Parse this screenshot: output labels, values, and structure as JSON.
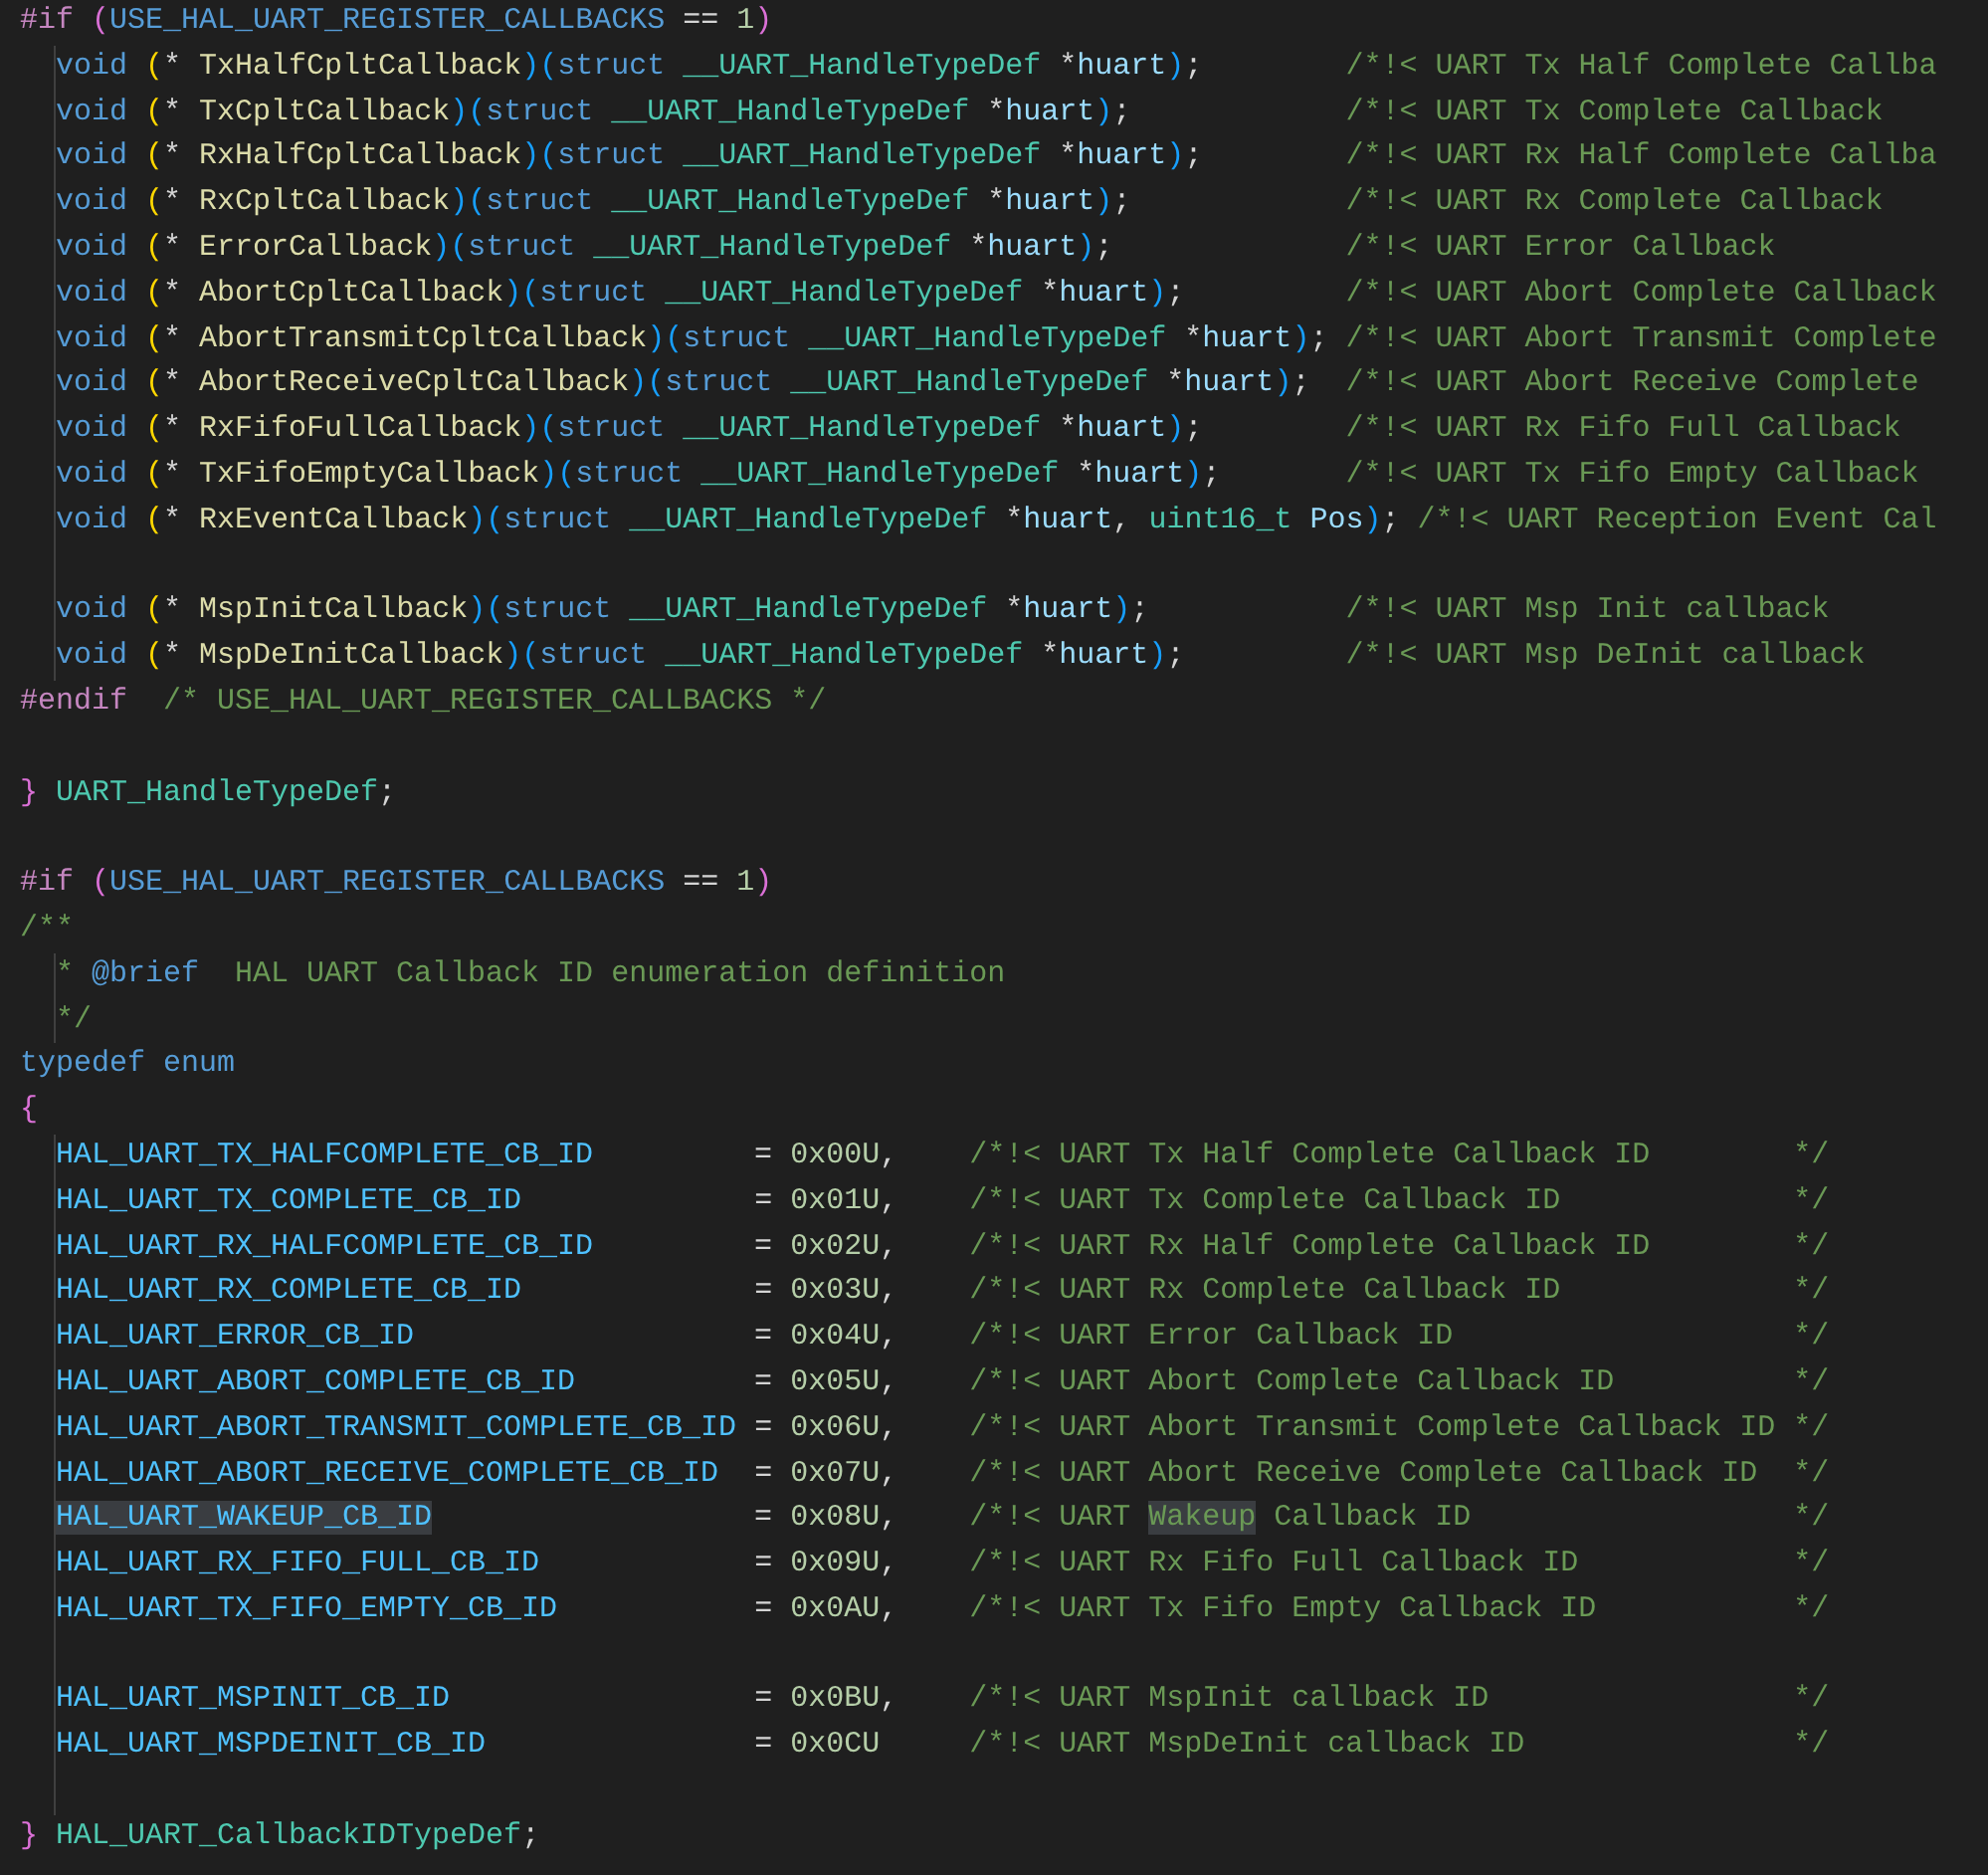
{
  "editor": {
    "lines": [
      {
        "nested": false,
        "tokens": [
          {
            "kind": "pp",
            "text": "#if "
          },
          {
            "kind": "b2",
            "text": "("
          },
          {
            "kind": "macro",
            "text": "USE_HAL_UART_REGISTER_CALLBACKS"
          },
          {
            "kind": "plain",
            "text": " == "
          },
          {
            "kind": "num",
            "text": "1"
          },
          {
            "kind": "b2",
            "text": ")"
          }
        ]
      },
      {
        "nested": true,
        "tokens": [
          {
            "kind": "kw",
            "text": "void "
          },
          {
            "kind": "b1",
            "text": "("
          },
          {
            "kind": "plain",
            "text": "* "
          },
          {
            "kind": "fn",
            "text": "TxHalfCpltCallback"
          },
          {
            "kind": "b3",
            "text": ")("
          },
          {
            "kind": "kw",
            "text": "struct "
          },
          {
            "kind": "type",
            "text": "__UART_HandleTypeDef "
          },
          {
            "kind": "plain",
            "text": "*"
          },
          {
            "kind": "param",
            "text": "huart"
          },
          {
            "kind": "b3",
            "text": ")"
          },
          {
            "kind": "plain",
            "text": ";        "
          },
          {
            "kind": "cm",
            "text": "/*!< UART Tx Half Complete Callba"
          }
        ]
      },
      {
        "nested": true,
        "tokens": [
          {
            "kind": "kw",
            "text": "void "
          },
          {
            "kind": "b1",
            "text": "("
          },
          {
            "kind": "plain",
            "text": "* "
          },
          {
            "kind": "fn",
            "text": "TxCpltCallback"
          },
          {
            "kind": "b3",
            "text": ")("
          },
          {
            "kind": "kw",
            "text": "struct "
          },
          {
            "kind": "type",
            "text": "__UART_HandleTypeDef "
          },
          {
            "kind": "plain",
            "text": "*"
          },
          {
            "kind": "param",
            "text": "huart"
          },
          {
            "kind": "b3",
            "text": ")"
          },
          {
            "kind": "plain",
            "text": ";            "
          },
          {
            "kind": "cm",
            "text": "/*!< UART Tx Complete Callback"
          }
        ]
      },
      {
        "nested": true,
        "tokens": [
          {
            "kind": "kw",
            "text": "void "
          },
          {
            "kind": "b1",
            "text": "("
          },
          {
            "kind": "plain",
            "text": "* "
          },
          {
            "kind": "fn",
            "text": "RxHalfCpltCallback"
          },
          {
            "kind": "b3",
            "text": ")("
          },
          {
            "kind": "kw",
            "text": "struct "
          },
          {
            "kind": "type",
            "text": "__UART_HandleTypeDef "
          },
          {
            "kind": "plain",
            "text": "*"
          },
          {
            "kind": "param",
            "text": "huart"
          },
          {
            "kind": "b3",
            "text": ")"
          },
          {
            "kind": "plain",
            "text": ";        "
          },
          {
            "kind": "cm",
            "text": "/*!< UART Rx Half Complete Callba"
          }
        ]
      },
      {
        "nested": true,
        "tokens": [
          {
            "kind": "kw",
            "text": "void "
          },
          {
            "kind": "b1",
            "text": "("
          },
          {
            "kind": "plain",
            "text": "* "
          },
          {
            "kind": "fn",
            "text": "RxCpltCallback"
          },
          {
            "kind": "b3",
            "text": ")("
          },
          {
            "kind": "kw",
            "text": "struct "
          },
          {
            "kind": "type",
            "text": "__UART_HandleTypeDef "
          },
          {
            "kind": "plain",
            "text": "*"
          },
          {
            "kind": "param",
            "text": "huart"
          },
          {
            "kind": "b3",
            "text": ")"
          },
          {
            "kind": "plain",
            "text": ";            "
          },
          {
            "kind": "cm",
            "text": "/*!< UART Rx Complete Callback"
          }
        ]
      },
      {
        "nested": true,
        "tokens": [
          {
            "kind": "kw",
            "text": "void "
          },
          {
            "kind": "b1",
            "text": "("
          },
          {
            "kind": "plain",
            "text": "* "
          },
          {
            "kind": "fn",
            "text": "ErrorCallback"
          },
          {
            "kind": "b3",
            "text": ")("
          },
          {
            "kind": "kw",
            "text": "struct "
          },
          {
            "kind": "type",
            "text": "__UART_HandleTypeDef "
          },
          {
            "kind": "plain",
            "text": "*"
          },
          {
            "kind": "param",
            "text": "huart"
          },
          {
            "kind": "b3",
            "text": ")"
          },
          {
            "kind": "plain",
            "text": ";             "
          },
          {
            "kind": "cm",
            "text": "/*!< UART Error Callback"
          }
        ]
      },
      {
        "nested": true,
        "tokens": [
          {
            "kind": "kw",
            "text": "void "
          },
          {
            "kind": "b1",
            "text": "("
          },
          {
            "kind": "plain",
            "text": "* "
          },
          {
            "kind": "fn",
            "text": "AbortCpltCallback"
          },
          {
            "kind": "b3",
            "text": ")("
          },
          {
            "kind": "kw",
            "text": "struct "
          },
          {
            "kind": "type",
            "text": "__UART_HandleTypeDef "
          },
          {
            "kind": "plain",
            "text": "*"
          },
          {
            "kind": "param",
            "text": "huart"
          },
          {
            "kind": "b3",
            "text": ")"
          },
          {
            "kind": "plain",
            "text": ";         "
          },
          {
            "kind": "cm",
            "text": "/*!< UART Abort Complete Callback"
          }
        ]
      },
      {
        "nested": true,
        "tokens": [
          {
            "kind": "kw",
            "text": "void "
          },
          {
            "kind": "b1",
            "text": "("
          },
          {
            "kind": "plain",
            "text": "* "
          },
          {
            "kind": "fn",
            "text": "AbortTransmitCpltCallback"
          },
          {
            "kind": "b3",
            "text": ")("
          },
          {
            "kind": "kw",
            "text": "struct "
          },
          {
            "kind": "type",
            "text": "__UART_HandleTypeDef "
          },
          {
            "kind": "plain",
            "text": "*"
          },
          {
            "kind": "param",
            "text": "huart"
          },
          {
            "kind": "b3",
            "text": ")"
          },
          {
            "kind": "plain",
            "text": "; "
          },
          {
            "kind": "cm",
            "text": "/*!< UART Abort Transmit Complete"
          }
        ]
      },
      {
        "nested": true,
        "tokens": [
          {
            "kind": "kw",
            "text": "void "
          },
          {
            "kind": "b1",
            "text": "("
          },
          {
            "kind": "plain",
            "text": "* "
          },
          {
            "kind": "fn",
            "text": "AbortReceiveCpltCallback"
          },
          {
            "kind": "b3",
            "text": ")("
          },
          {
            "kind": "kw",
            "text": "struct "
          },
          {
            "kind": "type",
            "text": "__UART_HandleTypeDef "
          },
          {
            "kind": "plain",
            "text": "*"
          },
          {
            "kind": "param",
            "text": "huart"
          },
          {
            "kind": "b3",
            "text": ")"
          },
          {
            "kind": "plain",
            "text": ";  "
          },
          {
            "kind": "cm",
            "text": "/*!< UART Abort Receive Complete"
          }
        ]
      },
      {
        "nested": true,
        "tokens": [
          {
            "kind": "kw",
            "text": "void "
          },
          {
            "kind": "b1",
            "text": "("
          },
          {
            "kind": "plain",
            "text": "* "
          },
          {
            "kind": "fn",
            "text": "RxFifoFullCallback"
          },
          {
            "kind": "b3",
            "text": ")("
          },
          {
            "kind": "kw",
            "text": "struct "
          },
          {
            "kind": "type",
            "text": "__UART_HandleTypeDef "
          },
          {
            "kind": "plain",
            "text": "*"
          },
          {
            "kind": "param",
            "text": "huart"
          },
          {
            "kind": "b3",
            "text": ")"
          },
          {
            "kind": "plain",
            "text": ";        "
          },
          {
            "kind": "cm",
            "text": "/*!< UART Rx Fifo Full Callback"
          }
        ]
      },
      {
        "nested": true,
        "tokens": [
          {
            "kind": "kw",
            "text": "void "
          },
          {
            "kind": "b1",
            "text": "("
          },
          {
            "kind": "plain",
            "text": "* "
          },
          {
            "kind": "fn",
            "text": "TxFifoEmptyCallback"
          },
          {
            "kind": "b3",
            "text": ")("
          },
          {
            "kind": "kw",
            "text": "struct "
          },
          {
            "kind": "type",
            "text": "__UART_HandleTypeDef "
          },
          {
            "kind": "plain",
            "text": "*"
          },
          {
            "kind": "param",
            "text": "huart"
          },
          {
            "kind": "b3",
            "text": ")"
          },
          {
            "kind": "plain",
            "text": ";       "
          },
          {
            "kind": "cm",
            "text": "/*!< UART Tx Fifo Empty Callback"
          }
        ]
      },
      {
        "nested": true,
        "tokens": [
          {
            "kind": "kw",
            "text": "void "
          },
          {
            "kind": "b1",
            "text": "("
          },
          {
            "kind": "plain",
            "text": "* "
          },
          {
            "kind": "fn",
            "text": "RxEventCallback"
          },
          {
            "kind": "b3",
            "text": ")("
          },
          {
            "kind": "kw",
            "text": "struct "
          },
          {
            "kind": "type",
            "text": "__UART_HandleTypeDef "
          },
          {
            "kind": "plain",
            "text": "*"
          },
          {
            "kind": "param",
            "text": "huart"
          },
          {
            "kind": "plain",
            "text": ", "
          },
          {
            "kind": "type",
            "text": "uint16_t "
          },
          {
            "kind": "param",
            "text": "Pos"
          },
          {
            "kind": "b3",
            "text": ")"
          },
          {
            "kind": "plain",
            "text": "; "
          },
          {
            "kind": "cm",
            "text": "/*!< UART Reception Event Cal"
          }
        ]
      },
      {
        "nested": true
      },
      {
        "nested": true,
        "tokens": [
          {
            "kind": "kw",
            "text": "void "
          },
          {
            "kind": "b1",
            "text": "("
          },
          {
            "kind": "plain",
            "text": "* "
          },
          {
            "kind": "fn",
            "text": "MspInitCallback"
          },
          {
            "kind": "b3",
            "text": ")("
          },
          {
            "kind": "kw",
            "text": "struct "
          },
          {
            "kind": "type",
            "text": "__UART_HandleTypeDef "
          },
          {
            "kind": "plain",
            "text": "*"
          },
          {
            "kind": "param",
            "text": "huart"
          },
          {
            "kind": "b3",
            "text": ")"
          },
          {
            "kind": "plain",
            "text": ";           "
          },
          {
            "kind": "cm",
            "text": "/*!< UART Msp Init callback"
          }
        ]
      },
      {
        "nested": true,
        "tokens": [
          {
            "kind": "kw",
            "text": "void "
          },
          {
            "kind": "b1",
            "text": "("
          },
          {
            "kind": "plain",
            "text": "* "
          },
          {
            "kind": "fn",
            "text": "MspDeInitCallback"
          },
          {
            "kind": "b3",
            "text": ")("
          },
          {
            "kind": "kw",
            "text": "struct "
          },
          {
            "kind": "type",
            "text": "__UART_HandleTypeDef "
          },
          {
            "kind": "plain",
            "text": "*"
          },
          {
            "kind": "param",
            "text": "huart"
          },
          {
            "kind": "b3",
            "text": ")"
          },
          {
            "kind": "plain",
            "text": ";         "
          },
          {
            "kind": "cm",
            "text": "/*!< UART Msp DeInit callback"
          }
        ]
      },
      {
        "nested": false,
        "tokens": [
          {
            "kind": "pp",
            "text": "#endif  "
          },
          {
            "kind": "cm",
            "text": "/* USE_HAL_UART_REGISTER_CALLBACKS */"
          }
        ]
      },
      {
        "nested": false
      },
      {
        "nested": false,
        "tokens": [
          {
            "kind": "b2",
            "text": "} "
          },
          {
            "kind": "type",
            "text": "UART_HandleTypeDef"
          },
          {
            "kind": "plain",
            "text": ";"
          }
        ]
      },
      {
        "nested": false
      },
      {
        "nested": false,
        "tokens": [
          {
            "kind": "pp",
            "text": "#if "
          },
          {
            "kind": "b2",
            "text": "("
          },
          {
            "kind": "macro",
            "text": "USE_HAL_UART_REGISTER_CALLBACKS"
          },
          {
            "kind": "plain",
            "text": " == "
          },
          {
            "kind": "num",
            "text": "1"
          },
          {
            "kind": "b2",
            "text": ")"
          }
        ]
      },
      {
        "nested": false,
        "tokens": [
          {
            "kind": "cm",
            "text": "/**"
          }
        ]
      },
      {
        "nested": true,
        "tokens": [
          {
            "kind": "cm",
            "text": "* "
          },
          {
            "kind": "kw",
            "text": "@brief"
          },
          {
            "kind": "cm",
            "text": "  HAL UART Callback ID enumeration definition"
          }
        ]
      },
      {
        "nested": true,
        "tokens": [
          {
            "kind": "cm",
            "text": "*/"
          }
        ]
      },
      {
        "nested": false,
        "tokens": [
          {
            "kind": "kw",
            "text": "typedef "
          },
          {
            "kind": "kw",
            "text": "enum"
          }
        ]
      },
      {
        "nested": false,
        "tokens": [
          {
            "kind": "b2",
            "text": "{"
          }
        ]
      },
      {
        "nested": true,
        "tokens": [
          {
            "kind": "const",
            "text": "HAL_UART_TX_HALFCOMPLETE_CB_ID"
          },
          {
            "kind": "plain",
            "text": "         = "
          },
          {
            "kind": "num",
            "text": "0x00U"
          },
          {
            "kind": "plain",
            "text": ",    "
          },
          {
            "kind": "cm",
            "text": "/*!< UART Tx Half Complete Callback ID        */"
          }
        ]
      },
      {
        "nested": true,
        "tokens": [
          {
            "kind": "const",
            "text": "HAL_UART_TX_COMPLETE_CB_ID"
          },
          {
            "kind": "plain",
            "text": "             = "
          },
          {
            "kind": "num",
            "text": "0x01U"
          },
          {
            "kind": "plain",
            "text": ",    "
          },
          {
            "kind": "cm",
            "text": "/*!< UART Tx Complete Callback ID             */"
          }
        ]
      },
      {
        "nested": true,
        "tokens": [
          {
            "kind": "const",
            "text": "HAL_UART_RX_HALFCOMPLETE_CB_ID"
          },
          {
            "kind": "plain",
            "text": "         = "
          },
          {
            "kind": "num",
            "text": "0x02U"
          },
          {
            "kind": "plain",
            "text": ",    "
          },
          {
            "kind": "cm",
            "text": "/*!< UART Rx Half Complete Callback ID        */"
          }
        ]
      },
      {
        "nested": true,
        "tokens": [
          {
            "kind": "const",
            "text": "HAL_UART_RX_COMPLETE_CB_ID"
          },
          {
            "kind": "plain",
            "text": "             = "
          },
          {
            "kind": "num",
            "text": "0x03U"
          },
          {
            "kind": "plain",
            "text": ",    "
          },
          {
            "kind": "cm",
            "text": "/*!< UART Rx Complete Callback ID             */"
          }
        ]
      },
      {
        "nested": true,
        "tokens": [
          {
            "kind": "const",
            "text": "HAL_UART_ERROR_CB_ID"
          },
          {
            "kind": "plain",
            "text": "                   = "
          },
          {
            "kind": "num",
            "text": "0x04U"
          },
          {
            "kind": "plain",
            "text": ",    "
          },
          {
            "kind": "cm",
            "text": "/*!< UART Error Callback ID                   */"
          }
        ]
      },
      {
        "nested": true,
        "tokens": [
          {
            "kind": "const",
            "text": "HAL_UART_ABORT_COMPLETE_CB_ID"
          },
          {
            "kind": "plain",
            "text": "          = "
          },
          {
            "kind": "num",
            "text": "0x05U"
          },
          {
            "kind": "plain",
            "text": ",    "
          },
          {
            "kind": "cm",
            "text": "/*!< UART Abort Complete Callback ID          */"
          }
        ]
      },
      {
        "nested": true,
        "tokens": [
          {
            "kind": "const",
            "text": "HAL_UART_ABORT_TRANSMIT_COMPLETE_CB_ID"
          },
          {
            "kind": "plain",
            "text": " = "
          },
          {
            "kind": "num",
            "text": "0x06U"
          },
          {
            "kind": "plain",
            "text": ",    "
          },
          {
            "kind": "cm",
            "text": "/*!< UART Abort Transmit Complete Callback ID */"
          }
        ]
      },
      {
        "nested": true,
        "tokens": [
          {
            "kind": "const",
            "text": "HAL_UART_ABORT_RECEIVE_COMPLETE_CB_ID"
          },
          {
            "kind": "plain",
            "text": "  = "
          },
          {
            "kind": "num",
            "text": "0x07U"
          },
          {
            "kind": "plain",
            "text": ",    "
          },
          {
            "kind": "cm",
            "text": "/*!< UART Abort Receive Complete Callback ID  */"
          }
        ]
      },
      {
        "nested": true,
        "tokens": [
          {
            "kind": "const_match",
            "text": "HAL_UART_WAKEUP_CB_ID"
          },
          {
            "kind": "plain",
            "text": "                  = "
          },
          {
            "kind": "num",
            "text": "0x08U"
          },
          {
            "kind": "plain",
            "text": ",    "
          },
          {
            "kind": "cm",
            "text": "/*!< UART "
          },
          {
            "kind": "cm_match",
            "text": "Wakeup"
          },
          {
            "kind": "cm",
            "text": " Callback ID                  */"
          }
        ]
      },
      {
        "nested": true,
        "tokens": [
          {
            "kind": "const",
            "text": "HAL_UART_RX_FIFO_FULL_CB_ID"
          },
          {
            "kind": "plain",
            "text": "            = "
          },
          {
            "kind": "num",
            "text": "0x09U"
          },
          {
            "kind": "plain",
            "text": ",    "
          },
          {
            "kind": "cm",
            "text": "/*!< UART Rx Fifo Full Callback ID            */"
          }
        ]
      },
      {
        "nested": true,
        "tokens": [
          {
            "kind": "const",
            "text": "HAL_UART_TX_FIFO_EMPTY_CB_ID"
          },
          {
            "kind": "plain",
            "text": "           = "
          },
          {
            "kind": "num",
            "text": "0x0AU"
          },
          {
            "kind": "plain",
            "text": ",    "
          },
          {
            "kind": "cm",
            "text": "/*!< UART Tx Fifo Empty Callback ID           */"
          }
        ]
      },
      {
        "nested": true
      },
      {
        "nested": true,
        "tokens": [
          {
            "kind": "const",
            "text": "HAL_UART_MSPINIT_CB_ID"
          },
          {
            "kind": "plain",
            "text": "                 = "
          },
          {
            "kind": "num",
            "text": "0x0BU"
          },
          {
            "kind": "plain",
            "text": ",    "
          },
          {
            "kind": "cm",
            "text": "/*!< UART MspInit callback ID                 */"
          }
        ]
      },
      {
        "nested": true,
        "tokens": [
          {
            "kind": "const",
            "text": "HAL_UART_MSPDEINIT_CB_ID"
          },
          {
            "kind": "plain",
            "text": "               = "
          },
          {
            "kind": "num",
            "text": "0x0CU     "
          },
          {
            "kind": "cm",
            "text": "/*!< UART MspDeInit callback ID               */"
          }
        ]
      },
      {
        "nested": true
      },
      {
        "nested": false,
        "tokens": [
          {
            "kind": "b2",
            "text": "} "
          },
          {
            "kind": "type",
            "text": "HAL_UART_CallbackIDTypeDef"
          },
          {
            "kind": "plain",
            "text": ";"
          }
        ]
      }
    ]
  }
}
